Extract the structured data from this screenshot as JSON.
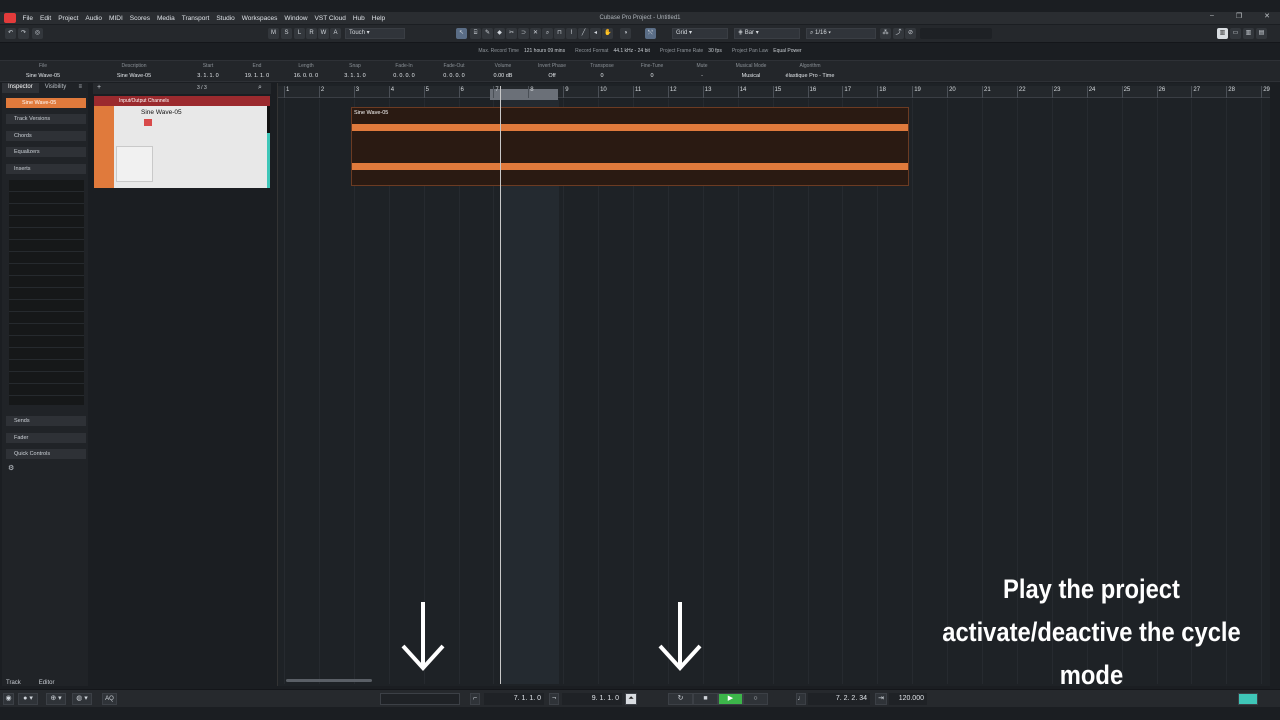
{
  "window": {
    "title": "Cubase Pro Project - Untitled1",
    "controls": [
      "–",
      "❐",
      "✕"
    ]
  },
  "menu": [
    "File",
    "Edit",
    "Project",
    "Audio",
    "MIDI",
    "Scores",
    "Media",
    "Transport",
    "Studio",
    "Workspaces",
    "Window",
    "VST Cloud",
    "Hub",
    "Help"
  ],
  "toolbar": {
    "m": "M",
    "s": "S",
    "l": "L",
    "r": "R",
    "w": "W",
    "a": "A",
    "automation_mode": "Touch",
    "snap_type": "Grid",
    "grid_type": "Bar",
    "quantize": "1/16"
  },
  "status": [
    {
      "label": "Max. Record Time",
      "value": "121 hours 09 mins"
    },
    {
      "label": "Record Format",
      "value": "44.1 kHz - 24 bit"
    },
    {
      "label": "Project Frame Rate",
      "value": "30 fps"
    },
    {
      "label": "Project Pan Law",
      "value": "Equal Power"
    }
  ],
  "info": [
    {
      "label": "File",
      "value": "Sine Wave-05"
    },
    {
      "label": "Description",
      "value": "Sine Wave-05"
    },
    {
      "label": "Start",
      "value": "3. 1. 1.   0"
    },
    {
      "label": "End",
      "value": "19. 1. 1.   0"
    },
    {
      "label": "Length",
      "value": "16. 0. 0.   0"
    },
    {
      "label": "Snap",
      "value": "3. 1. 1.   0"
    },
    {
      "label": "Fade-In",
      "value": "0. 0. 0.   0"
    },
    {
      "label": "Fade-Out",
      "value": "0. 0. 0.   0"
    },
    {
      "label": "Volume",
      "value": "0.00       dB"
    },
    {
      "label": "Invert Phase",
      "value": "Off"
    },
    {
      "label": "Transpose",
      "value": "0"
    },
    {
      "label": "Fine-Tune",
      "value": "0"
    },
    {
      "label": "Mute",
      "value": "-"
    },
    {
      "label": "Musical Mode",
      "value": "Musical"
    },
    {
      "label": "Algorithm",
      "value": "élastique Pro - Time"
    }
  ],
  "inspector": {
    "tabs": [
      "Inspector",
      "Visibility"
    ],
    "track_name": "Sine Wave-05",
    "sections": [
      "Track Versions",
      "Chords",
      "Equalizers",
      "Inserts"
    ],
    "lower_sections": [
      "Sends",
      "Fader",
      "Quick Controls"
    ],
    "bottom_tabs": [
      "Track",
      "Editor"
    ]
  },
  "tracklist": {
    "counter": "3 / 3",
    "folder_name": "Input/Output Channels",
    "track_name": "Sine Wave-05"
  },
  "ruler": {
    "bars": [
      "1",
      "2",
      "3",
      "4",
      "5",
      "6",
      "7",
      "8",
      "9",
      "10",
      "11",
      "12",
      "13",
      "14",
      "15",
      "16",
      "17",
      "18",
      "19",
      "20",
      "21",
      "22",
      "23",
      "24",
      "25",
      "26",
      "27",
      "28",
      "29"
    ]
  },
  "event": {
    "name": "Sine Wave-05"
  },
  "overlay": {
    "line1": "Play the project",
    "line2": "activate/deactive the cycle mode"
  },
  "transport": {
    "left_locator": "7.  1.  1.    0",
    "right_locator": "9.  1.  1.    0",
    "position": "7.  2.  2.  34",
    "tempo": "120.000",
    "aq": "AQ"
  }
}
